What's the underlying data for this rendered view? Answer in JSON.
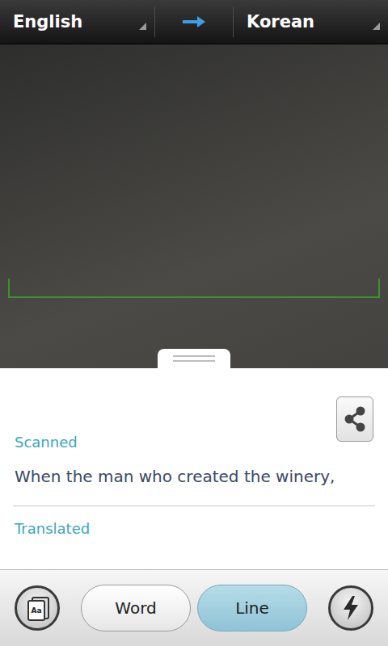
{
  "languages": {
    "source": "English",
    "target": "Korean"
  },
  "result": {
    "scanned_label": "Scanned",
    "scanned_text": "When the man who created the winery,",
    "translated_label": "Translated"
  },
  "toolbar": {
    "card_icon_text": "Aa",
    "modes": [
      {
        "label": "Word",
        "selected": false
      },
      {
        "label": "Line",
        "selected": true
      }
    ]
  }
}
